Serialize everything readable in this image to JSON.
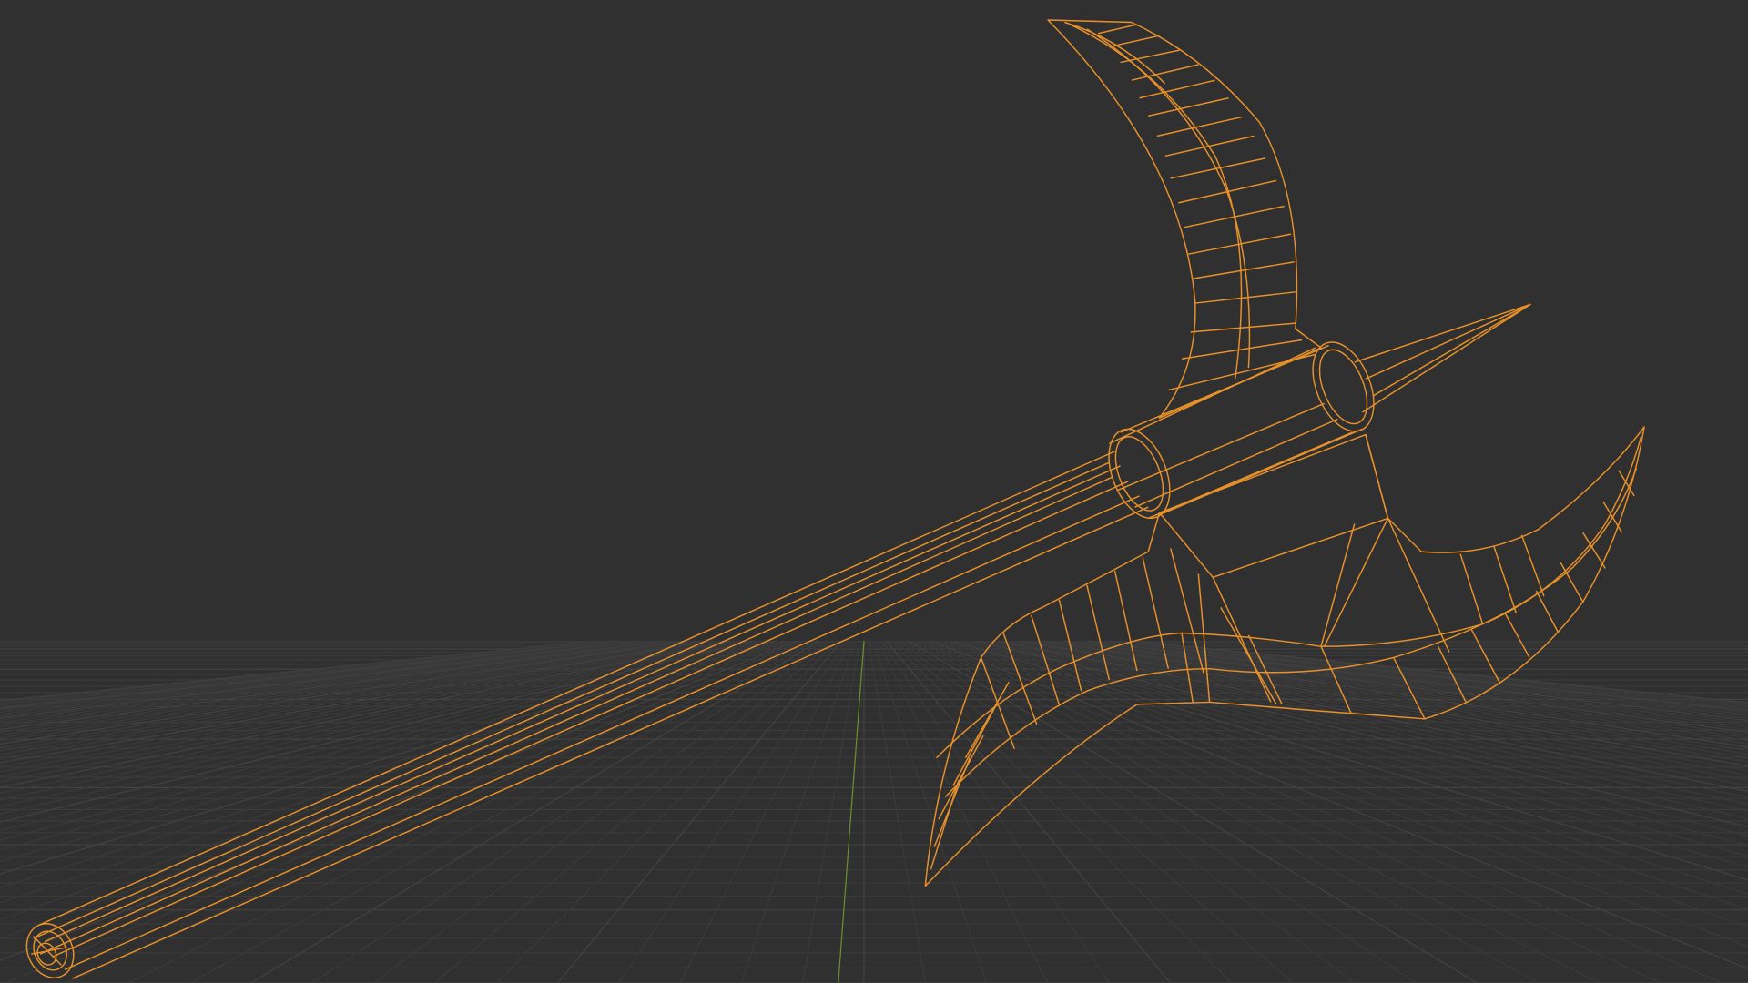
{
  "app": {
    "view_mode": "wireframe",
    "object_name_shown": null
  },
  "colors": {
    "background": "#303030",
    "grid_line": "#3a3a3a",
    "grid_line_major": "#424242",
    "y_axis": "#6b8f2d",
    "wire": "#e8912a"
  },
  "icons": {
    "viewport_object": "battle-axe-icon"
  }
}
